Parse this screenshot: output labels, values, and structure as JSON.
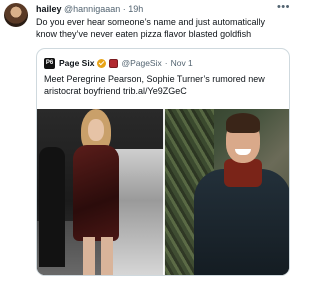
{
  "tweet": {
    "author": {
      "name": "hailey",
      "handle": "@hannigaaan",
      "separator": "·",
      "time": "19h"
    },
    "more_icon": "more-horizontal-icon",
    "text": "Do you ever hear someone’s name and just automatically know they’ve never eaten pizza flavor blasted goldfish"
  },
  "quote": {
    "logo_text": "P6",
    "name": "Page Six",
    "verified_icon": "gold-verified-badge-icon",
    "affiliate_icon": "business-affiliate-badge-icon",
    "handle": "@PageSix",
    "separator": "·",
    "date": "Nov 1",
    "text": "Meet Peregrine Pearson, Sophie Turner’s rumored new aristocrat boyfriend trib.al/Ye9ZGeC"
  },
  "colors": {
    "text_primary": "#0f1419",
    "text_secondary": "#536471",
    "border": "#cfd9de",
    "verified_gold": "#e8a317",
    "affiliate_red": "#b1282f"
  }
}
